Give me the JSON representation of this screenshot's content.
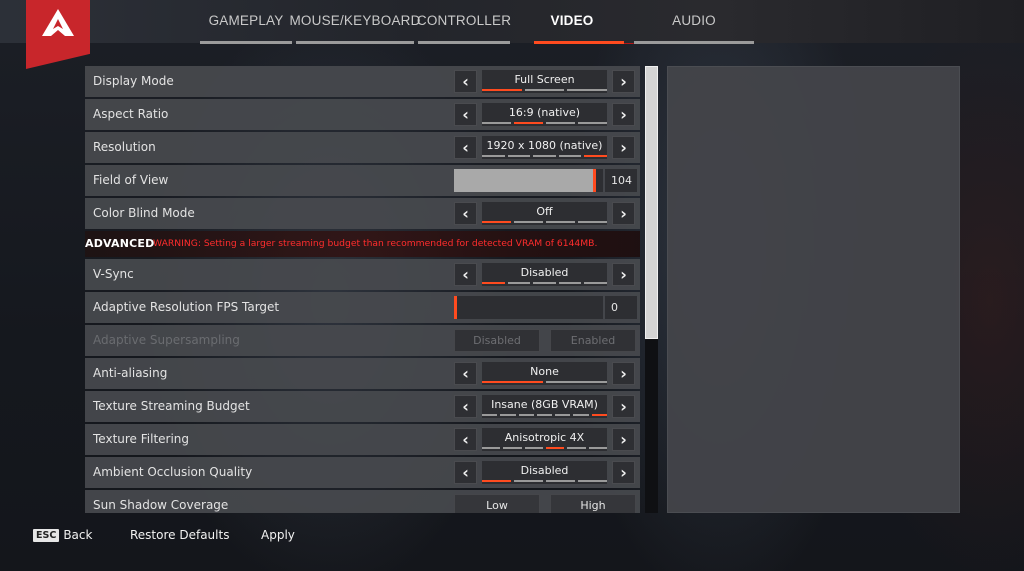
{
  "brand": {
    "logo_icon": "apex-legends-logo-icon",
    "accent": "#ff4b1f",
    "logo_color": "#c8262b",
    "warning_color": "#ff2d2d"
  },
  "tabs": [
    {
      "label": "GAMEPLAY",
      "active": false
    },
    {
      "label": "MOUSE/KEYBOARD",
      "active": false
    },
    {
      "label": "CONTROLLER",
      "active": false
    },
    {
      "label": "VIDEO",
      "active": true
    },
    {
      "label": "AUDIO",
      "active": false
    }
  ],
  "settings": [
    {
      "label": "Display Mode",
      "type": "selector",
      "value": "Full Screen",
      "options_count": 3,
      "selected_index": 0
    },
    {
      "label": "Aspect Ratio",
      "type": "selector",
      "value": "16:9 (native)",
      "options_count": 4,
      "selected_index": 1
    },
    {
      "label": "Resolution",
      "type": "selector",
      "value": "1920 x 1080 (native)",
      "options_count": 5,
      "selected_index": 4
    },
    {
      "label": "Field of View",
      "type": "slider",
      "value": "104",
      "fraction": 0.95
    },
    {
      "label": "Color Blind Mode",
      "type": "selector",
      "value": "Off",
      "options_count": 4,
      "selected_index": 0
    }
  ],
  "advanced": {
    "title": "ADVANCED",
    "warning": "WARNING: Setting a larger streaming budget than recommended for detected VRAM of 6144MB."
  },
  "advanced_settings": [
    {
      "label": "V-Sync",
      "type": "selector",
      "value": "Disabled",
      "options_count": 5,
      "selected_index": 0
    },
    {
      "label": "Adaptive Resolution FPS Target",
      "type": "slider",
      "value": "0",
      "fraction": 0.0
    },
    {
      "label": "Adaptive Supersampling",
      "type": "toggle",
      "disabled": true,
      "options": [
        "Disabled",
        "Enabled"
      ]
    },
    {
      "label": "Anti-aliasing",
      "type": "selector",
      "value": "None",
      "options_count": 2,
      "selected_index": 0
    },
    {
      "label": "Texture Streaming Budget",
      "type": "selector",
      "value": "Insane (8GB VRAM)",
      "options_count": 7,
      "selected_index": 6
    },
    {
      "label": "Texture Filtering",
      "type": "selector",
      "value": "Anisotropic 4X",
      "options_count": 6,
      "selected_index": 3
    },
    {
      "label": "Ambient Occlusion Quality",
      "type": "selector",
      "value": "Disabled",
      "options_count": 4,
      "selected_index": 0
    },
    {
      "label": "Sun Shadow Coverage",
      "type": "toggle",
      "disabled": false,
      "options": [
        "Low",
        "High"
      ]
    }
  ],
  "scroll": {
    "fraction_visible": 0.61,
    "position": 0.0
  },
  "footer": {
    "esc_key": "ESC",
    "back_label": "Back",
    "restore_label": "Restore Defaults",
    "apply_label": "Apply"
  }
}
